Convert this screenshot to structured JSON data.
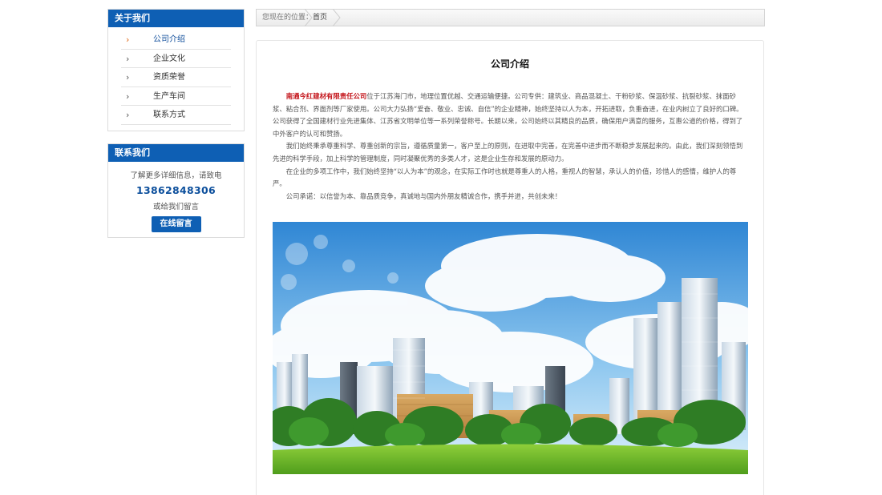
{
  "sidebar": {
    "about": {
      "title": "关于我们",
      "items": [
        {
          "label": "公司介绍",
          "active": true
        },
        {
          "label": "企业文化"
        },
        {
          "label": "资质荣誉"
        },
        {
          "label": "生产车间"
        },
        {
          "label": "联系方式"
        }
      ]
    },
    "contact": {
      "title": "联系我们",
      "intro": "了解更多详细信息，请致电",
      "phone": "13862848306",
      "alt": "或给我们留言",
      "button_label": "在线留言"
    }
  },
  "breadcrumb": {
    "label": "您现在的位置：",
    "home": "首页"
  },
  "main": {
    "title": "公司介绍",
    "company_name": "南通今红建材有限责任公司",
    "p1_rest": "位于江苏海门市，地理位置优越、交通运输便捷。公司专供：建筑业、商品混凝土、干粉砂浆、保温砂浆、抗裂砂浆、抹面砂浆、粘合剂、界面剂等厂家使用。公司大力弘扬“爱奋、敬业、忠诚、自信”的企业精神，始终坚持以人为本，开拓进取，负重奋进，在业内树立了良好的口碑。公司获得了全国建材行业先进集体、江苏省文明单位等一系列荣誉称号。长期以来，公司始终以其精良的品质，确保用户满意的服务，互惠公道的价格，得到了中外客户的认可和赞扬。",
    "p2": "我们始终秉承尊重科学、尊重创新的宗旨，遵循质量第一，客户至上的原则，在进取中完善，在完善中进步而不断稳步发展起来的。由此，我们深刻领悟到先进的科学手段，加上科学的管理制度，同时凝聚优秀的多类人才，这是企业生存和发展的原动力。",
    "p3": "在企业的多项工作中，我们始终坚持“以人为本”的观念，在实际工作时也就是尊重人的人格，重视人的智慧，承认人的价值，珍惜人的感情，维护人的尊严。",
    "p4": "公司承诺：以信誉为本、靠品质竞争，真诚地与国内外朋友精诚合作，携手并进，共创未来！"
  },
  "colors": {
    "brand_blue": "#0e5fb4",
    "company_red": "#c4161c",
    "active_arrow": "#e06a1a"
  },
  "icons": {
    "nav_arrow": "chevron-right-icon",
    "breadcrumb_separator": "breadcrumb-chevron-icon"
  }
}
